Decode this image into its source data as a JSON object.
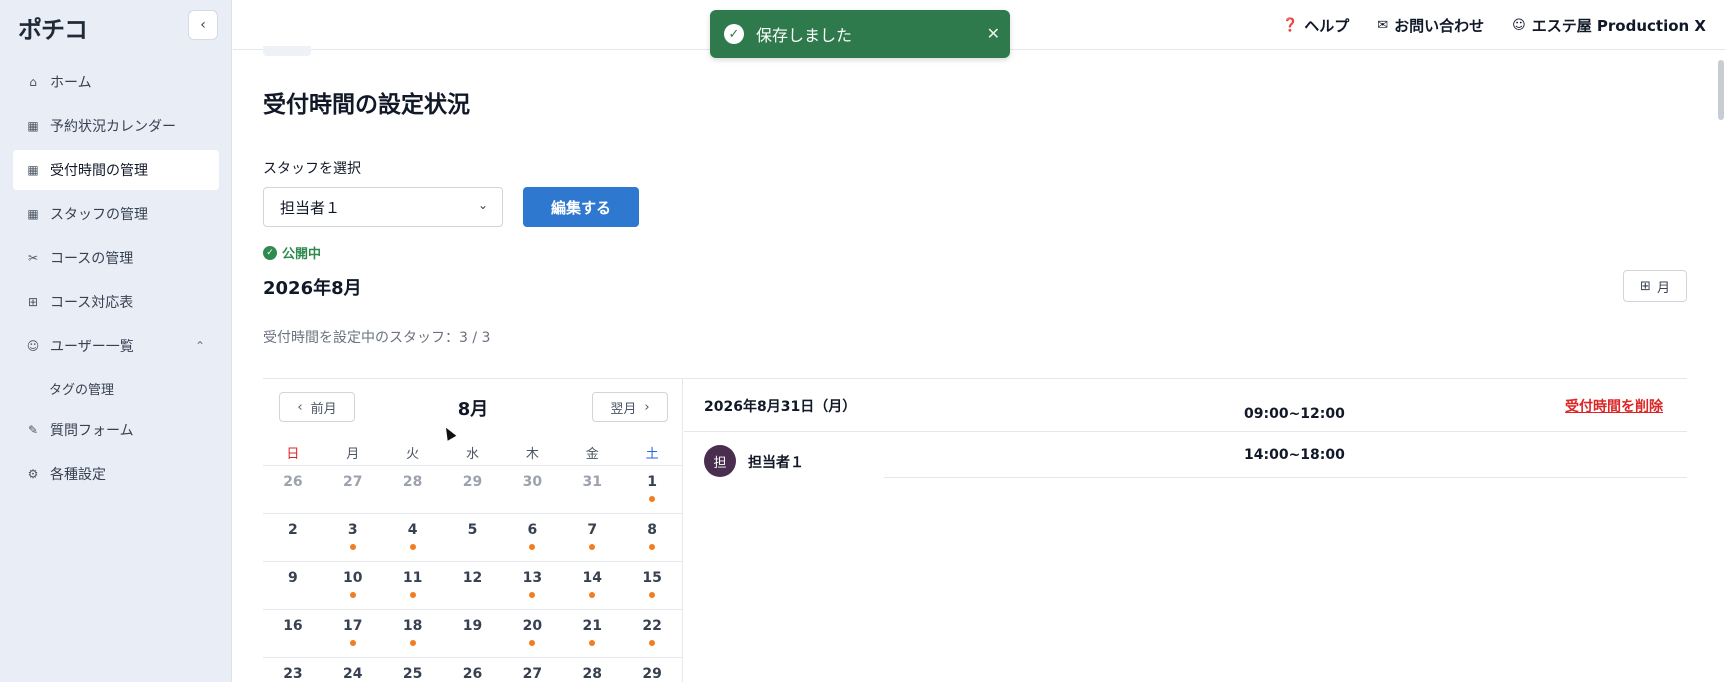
{
  "app": {
    "logo": "ポチコ",
    "collapse_icon": "chevron-left-icon"
  },
  "sidebar": {
    "items": [
      {
        "label": "ホーム",
        "icon": "home-icon"
      },
      {
        "label": "予約状況カレンダー",
        "icon": "calendar-icon"
      },
      {
        "label": "受付時間の管理",
        "icon": "calendar-check-icon",
        "active": true
      },
      {
        "label": "スタッフの管理",
        "icon": "calendar-user-icon"
      },
      {
        "label": "コースの管理",
        "icon": "scissors-icon"
      },
      {
        "label": "コース対応表",
        "icon": "grid-icon"
      },
      {
        "label": "ユーザー一覧",
        "icon": "user-icon",
        "expanded": true
      },
      {
        "label": "タグの管理",
        "sub": true
      },
      {
        "label": "質問フォーム",
        "icon": "edit-icon"
      },
      {
        "label": "各種設定",
        "icon": "gear-icon"
      }
    ]
  },
  "header": {
    "help": "ヘルプ",
    "contact": "お問い合わせ",
    "account": "エステ屋 Production X"
  },
  "toast": {
    "message": "保存しました",
    "color": "#2f7a4d"
  },
  "main": {
    "title": "受付時間の設定状況",
    "staff_label": "スタッフを選択",
    "staff_selected": "担当者１",
    "edit_button": "編集する",
    "status": "公開中",
    "month_title": "2026年8月",
    "view_toggle": "月",
    "staff_count": "受付時間を設定中のスタッフ：3 / 3"
  },
  "calendar": {
    "prev": "前月",
    "next": "翌月",
    "month": "8月",
    "weekdays": [
      "日",
      "月",
      "火",
      "水",
      "木",
      "金",
      "土"
    ],
    "weeks": [
      [
        {
          "d": "26",
          "other": true
        },
        {
          "d": "27",
          "other": true
        },
        {
          "d": "28",
          "other": true
        },
        {
          "d": "29",
          "other": true
        },
        {
          "d": "30",
          "other": true
        },
        {
          "d": "31",
          "other": true
        },
        {
          "d": "1",
          "mark": true
        }
      ],
      [
        {
          "d": "2"
        },
        {
          "d": "3",
          "mark": true
        },
        {
          "d": "4",
          "mark": true
        },
        {
          "d": "5"
        },
        {
          "d": "6",
          "mark": true
        },
        {
          "d": "7",
          "mark": true
        },
        {
          "d": "8",
          "mark": true
        }
      ],
      [
        {
          "d": "9"
        },
        {
          "d": "10",
          "mark": true
        },
        {
          "d": "11",
          "mark": true
        },
        {
          "d": "12"
        },
        {
          "d": "13",
          "mark": true
        },
        {
          "d": "14",
          "mark": true
        },
        {
          "d": "15",
          "mark": true
        }
      ],
      [
        {
          "d": "16"
        },
        {
          "d": "17",
          "mark": true
        },
        {
          "d": "18",
          "mark": true
        },
        {
          "d": "19"
        },
        {
          "d": "20",
          "mark": true
        },
        {
          "d": "21",
          "mark": true
        },
        {
          "d": "22",
          "mark": true
        }
      ],
      [
        {
          "d": "23"
        },
        {
          "d": "24"
        },
        {
          "d": "25"
        },
        {
          "d": "26"
        },
        {
          "d": "27"
        },
        {
          "d": "28"
        },
        {
          "d": "29"
        }
      ]
    ]
  },
  "detail": {
    "date": "2026年8月31日（月）",
    "delete_link": "受付時間を削除",
    "avatar": "担",
    "staff_name": "担当者１",
    "slots": [
      "09:00~12:00",
      "14:00~18:00"
    ]
  }
}
